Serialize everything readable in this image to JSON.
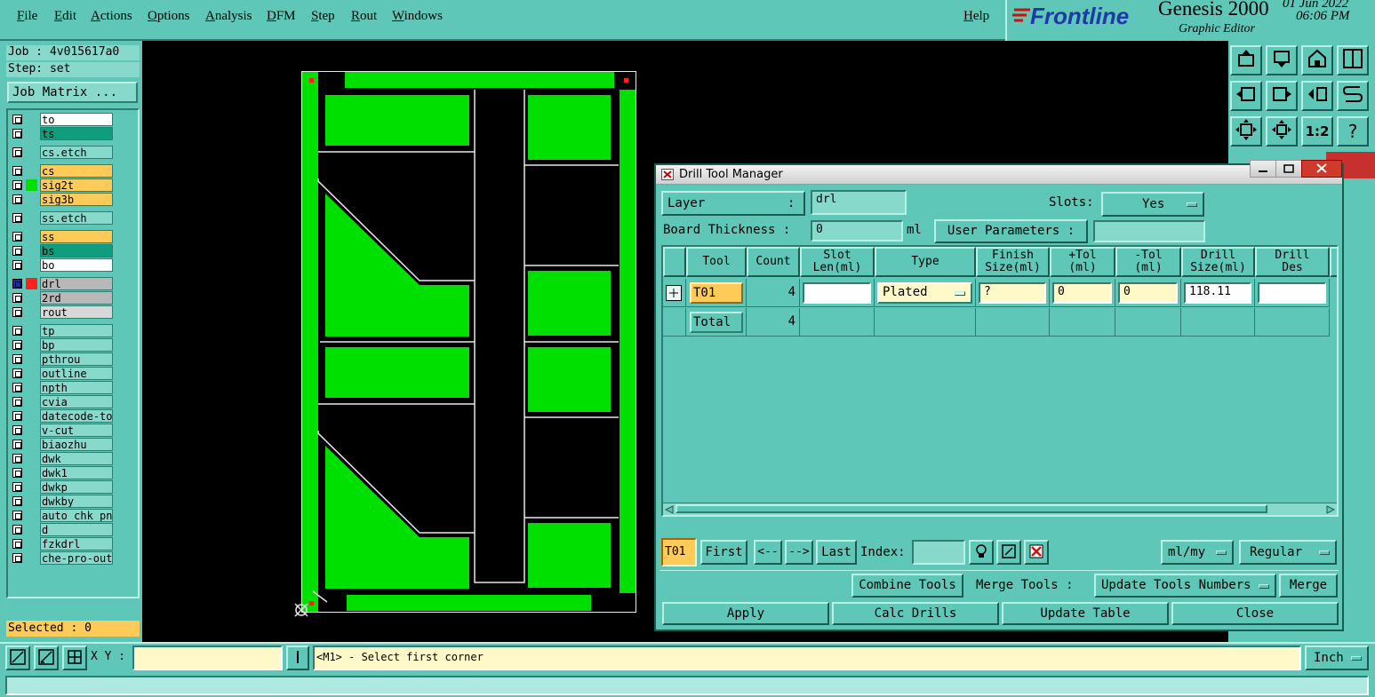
{
  "menubar": {
    "items": [
      "File",
      "Edit",
      "Actions",
      "Options",
      "Analysis",
      "DFM",
      "Step",
      "Rout",
      "Windows"
    ],
    "help": "Help"
  },
  "brand": {
    "logo": "Frontline",
    "product": "Genesis 2000",
    "subtitle": "Graphic Editor",
    "date": "01 Jun 2022",
    "time": "06:06 PM"
  },
  "left": {
    "job": "Job : 4v015617a0",
    "step": "Step: set",
    "job_matrix": "Job Matrix ...",
    "selected": "Selected : 0",
    "layers": [
      {
        "name": "to",
        "color": "#ffffff"
      },
      {
        "name": "ts",
        "color": "#0f9d7d"
      },
      {
        "name": "cs.etch",
        "color": "#86d9cb"
      },
      {
        "name": "cs",
        "color": "#ffcb58"
      },
      {
        "name": "sig2t",
        "color": "#ffcb58",
        "mark": "#00e000"
      },
      {
        "name": "sig3b",
        "color": "#ffcb58"
      },
      {
        "name": "ss.etch",
        "color": "#86d9cb"
      },
      {
        "name": "ss",
        "color": "#ffcb58"
      },
      {
        "name": "bs",
        "color": "#0f9d7d"
      },
      {
        "name": "bo",
        "color": "#ffffff"
      },
      {
        "name": "drl",
        "color": "#b8b8b8",
        "mark": "#ff2020",
        "active": true
      },
      {
        "name": "2rd",
        "color": "#b8b8b8"
      },
      {
        "name": "rout",
        "color": "#d8d8d8"
      },
      {
        "name": "tp",
        "color": "#86d9cb"
      },
      {
        "name": "bp",
        "color": "#86d9cb"
      },
      {
        "name": "pthrou",
        "color": "#86d9cb"
      },
      {
        "name": "outline",
        "color": "#86d9cb"
      },
      {
        "name": "npth",
        "color": "#86d9cb"
      },
      {
        "name": "cvia",
        "color": "#86d9cb"
      },
      {
        "name": "datecode-to",
        "color": "#86d9cb"
      },
      {
        "name": "v-cut",
        "color": "#86d9cb"
      },
      {
        "name": "biaozhu",
        "color": "#86d9cb"
      },
      {
        "name": "dwk",
        "color": "#86d9cb"
      },
      {
        "name": "dwk1",
        "color": "#86d9cb"
      },
      {
        "name": "dwkp",
        "color": "#86d9cb"
      },
      {
        "name": "dwkby",
        "color": "#86d9cb"
      },
      {
        "name": "auto_chk_pnl",
        "color": "#86d9cb"
      },
      {
        "name": "d",
        "color": "#86d9cb"
      },
      {
        "name": "fzkdrl",
        "color": "#86d9cb"
      },
      {
        "name": "che-pro-out",
        "color": "#86d9cb"
      }
    ]
  },
  "right_toolbar": {
    "icons": [
      "layer-up-icon",
      "layer-down-icon",
      "home-icon",
      "split-view-icon",
      "pan-left-icon",
      "pan-right-icon",
      "flip-icon",
      "snap-icon",
      "fit-screen-icon",
      "zoom-center-icon",
      "ratio-icon",
      "help-icon"
    ],
    "ratio_label": "1:2",
    "help_label": "?"
  },
  "dialog": {
    "title": "Drill Tool Manager",
    "layer_label": "Layer",
    "layer_colon": ":",
    "layer_value": "drl",
    "slots_label": "Slots:",
    "slots_value": "Yes",
    "thickness_label": "Board Thickness :",
    "thickness_value": "0",
    "thickness_unit": "ml",
    "user_params_label": "User Parameters :",
    "user_params_value": "",
    "columns": [
      {
        "l1": "Tool",
        "l2": ""
      },
      {
        "l1": "Count",
        "l2": ""
      },
      {
        "l1": "Slot",
        "l2": "Len(ml)"
      },
      {
        "l1": "Type",
        "l2": ""
      },
      {
        "l1": "Finish",
        "l2": "Size(ml)"
      },
      {
        "l1": "+Tol",
        "l2": "(ml)"
      },
      {
        "l1": "-Tol",
        "l2": "(ml)"
      },
      {
        "l1": "Drill",
        "l2": "Size(ml)"
      },
      {
        "l1": "Drill",
        "l2": "Des"
      }
    ],
    "row": {
      "tool": "T01",
      "count": "4",
      "slot_len": "",
      "type": "Plated",
      "finish": "?",
      "plus_tol": "0",
      "minus_tol": "0",
      "drill_size": "118.11",
      "drill_des": ""
    },
    "total": {
      "label": "Total",
      "count": "4"
    },
    "nav": {
      "current": "T01",
      "first": "First",
      "prev": "<--",
      "next": "-->",
      "last": "Last",
      "index_label": "Index:",
      "index_value": "",
      "units": "ml/my",
      "mode": "Regular"
    },
    "combine": "Combine Tools",
    "merge_label": "Merge Tools :",
    "merge_option": "Update Tools Numbers",
    "merge": "Merge",
    "apply": "Apply",
    "calc": "Calc Drills",
    "update": "Update Table",
    "close": "Close"
  },
  "status": {
    "xy_label": "X Y :",
    "xy_value": "",
    "prompt": "<M1> - Select first corner",
    "units": "Inch"
  }
}
